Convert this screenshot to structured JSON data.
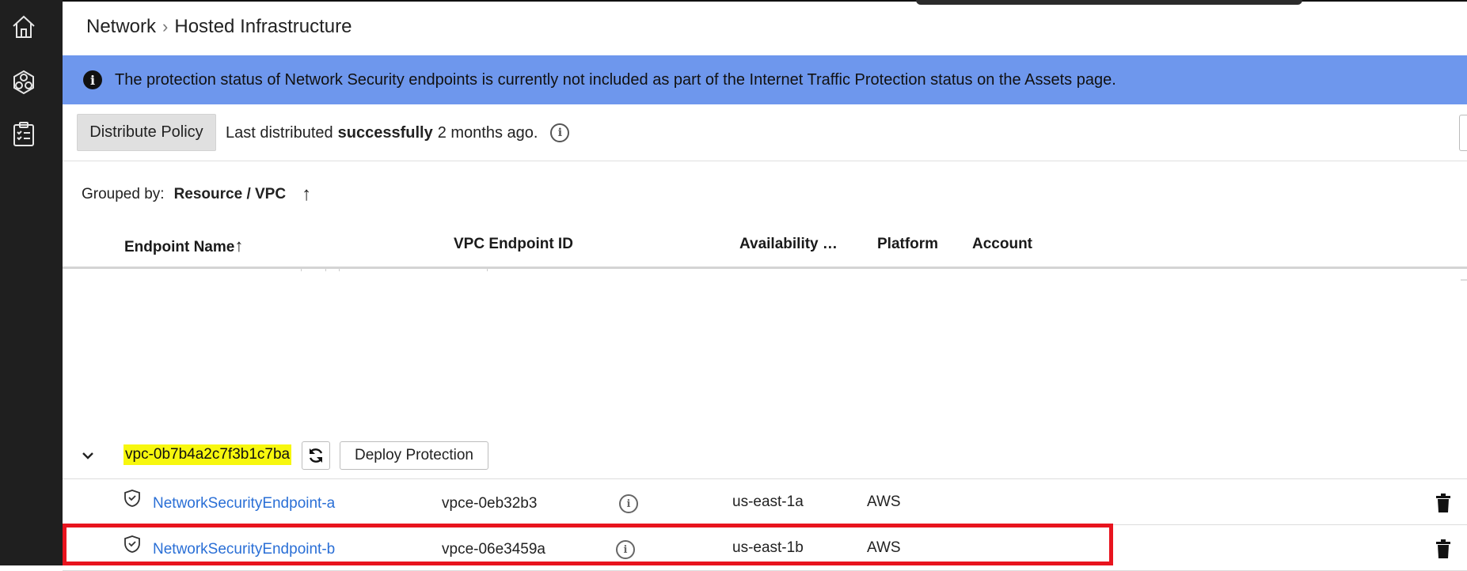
{
  "sidebar": {
    "items": [
      {
        "icon": "home-icon"
      },
      {
        "icon": "network-hexagon-icon"
      },
      {
        "icon": "clipboard-checklist-icon"
      }
    ]
  },
  "breadcrumb": {
    "parent": "Network",
    "separator": "›",
    "current": "Hosted Infrastructure"
  },
  "banner": {
    "icon": "info-icon",
    "text": "The protection status of Network Security endpoints is currently not included as part of the Internet Traffic Protection status on the Assets page."
  },
  "policy": {
    "button_label": "Distribute Policy",
    "status_prefix": "Last distributed",
    "status_strong": "successfully",
    "status_suffix": "2 months ago."
  },
  "grouping": {
    "label": "Grouped by:",
    "value": "Resource / VPC",
    "sort_arrow": "↑"
  },
  "table": {
    "columns": {
      "endpoint_name": "Endpoint Name",
      "endpoint_sort_arrow": "↑",
      "vpc_endpoint_id": "VPC Endpoint ID",
      "availability": "Availability …",
      "platform": "Platform",
      "account": "Account"
    },
    "group": {
      "vpc_id": "vpc-0b7b4a2c7f3b1c7ba",
      "deploy_label": "Deploy Protection",
      "highlight_color": "#f7f70e"
    },
    "rows": [
      {
        "name": "NetworkSecurityEndpoint-a",
        "vpce": "vpce-0eb32b3",
        "az": "us-east-1a",
        "platform": "AWS"
      },
      {
        "name": "NetworkSecurityEndpoint-b",
        "vpce": "vpce-06e3459a",
        "az": "us-east-1b",
        "platform": "AWS"
      }
    ]
  },
  "colors": {
    "sidebar": "#1f1f1f",
    "banner": "#6e97ed",
    "link": "#2a6fd6",
    "annotation_box": "#e8141e"
  }
}
